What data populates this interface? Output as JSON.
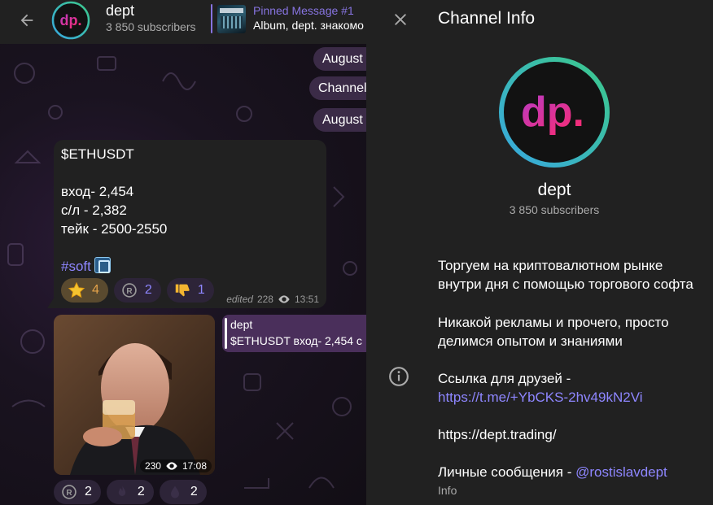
{
  "colors": {
    "accent": "#8774e1",
    "link": "#8e86ff",
    "header_bg": "#212121",
    "panel_bg": "#212121",
    "bubble_bg": "#212121",
    "date_pill_bg": "#3b2b47",
    "reaction_chosen": "#e4a24a"
  },
  "chat": {
    "header": {
      "back_icon": "arrow-left-icon",
      "title": "dept",
      "subscribers": "3 850 subscribers",
      "pinned": {
        "title": "Pinned Message #1",
        "text": "Album, dept. знакомо"
      }
    },
    "date_pills": [
      "August",
      "Channel",
      "August"
    ],
    "message": {
      "lines": [
        "$ETHUSDT",
        "",
        "вход- 2,454",
        "с/л - 2,382",
        "тейк - 2500-2550",
        ""
      ],
      "hashtag": "#soft",
      "reactions": [
        {
          "icon": "star-icon",
          "count": "4",
          "chosen": true
        },
        {
          "icon": "registered-icon",
          "count": "2",
          "chosen": false
        },
        {
          "icon": "thumbs-down-icon",
          "count": "1",
          "chosen": false
        }
      ],
      "edited": "edited",
      "views": "228",
      "time": "13:51"
    },
    "photo_message": {
      "views": "230",
      "time": "17:08",
      "reply": {
        "name": "dept",
        "text": "$ETHUSDT вход- 2,454 с"
      },
      "reactions": [
        {
          "icon": "registered-icon",
          "count": "2"
        },
        {
          "icon": "fire-icon",
          "count": "2"
        },
        {
          "icon": "drop-icon",
          "count": "2"
        }
      ]
    }
  },
  "info": {
    "close_icon": "close-icon",
    "title": "Channel Info",
    "name": "dept",
    "subscribers": "3 850 subscribers",
    "logo_text": "dp.",
    "description": {
      "p1_l1": "Торгуем на криптовалютном рынке",
      "p1_l2": "внутри дня с помощью торгового софта",
      "p2_l1": "Никакой рекламы и прочего, просто",
      "p2_l2": "делимся опытом и знаниями",
      "p3_l1": "Ссылка для друзей -",
      "invite_link": "https://t.me/+YbCKS-2hv49kN2Vi",
      "site": "https://dept.trading/",
      "dm_prefix": "Личные сообщения - ",
      "dm_link": "@rostislavdept"
    },
    "caption": "Info"
  }
}
